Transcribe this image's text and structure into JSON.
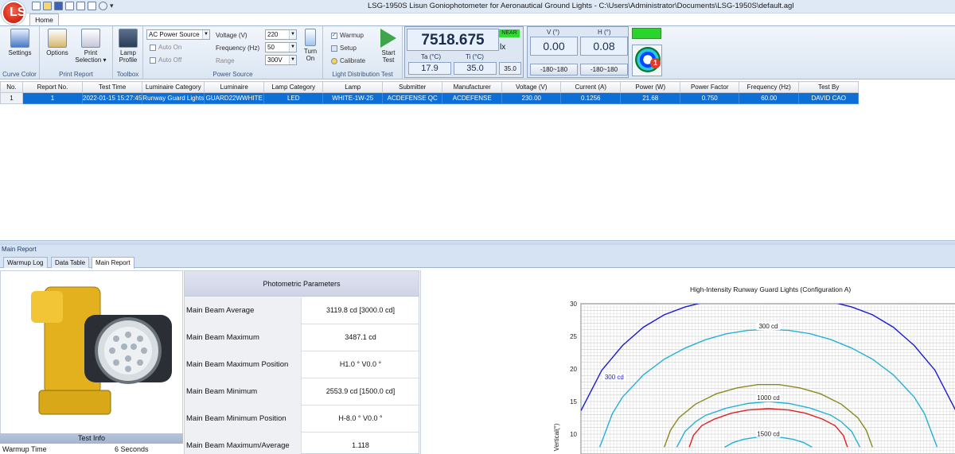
{
  "app": {
    "window_title": "LSG-1950S Lisun Goniophotometer for Aeronautical Ground Lights - C:\\Users\\Administrator\\Documents\\LSG-1950S\\default.agl",
    "logo_text": "LS",
    "ribbon_tab": "Home"
  },
  "ribbon": {
    "curve_color": {
      "settings": "Settings",
      "group": "Curve Color"
    },
    "print_report": {
      "options": "Options",
      "print_selection": "Print Selection ▾",
      "group": "Print Report"
    },
    "toolbox": {
      "lamp_profile": "Lamp Profile",
      "group": "Toolbox"
    },
    "power_source": {
      "source_select": "AC Power Source",
      "auto_on": "Auto On",
      "auto_off": "Auto Off",
      "voltage_label": "Voltage (V)",
      "voltage_value": "220",
      "frequency_label": "Frequency (Hz)",
      "frequency_value": "50",
      "range_label": "Range",
      "range_value": "300V",
      "turn_on": "Turn On",
      "group": "Power Source"
    },
    "light_test": {
      "warmup": "Warmup",
      "setup": "Setup",
      "calibrate": "Calibrate",
      "start": "Start Test",
      "group": "Light Distribution Test"
    }
  },
  "readout": {
    "value": "7518.675",
    "range_badge": "NEAR",
    "unit": "lx",
    "ta_label": "Ta (°C)",
    "ta_value": "17.9",
    "ti_label": "Ti (°C)",
    "ti_value": "35.0",
    "small_value": "35.0"
  },
  "angles": {
    "v_label": "V (°)",
    "v_value": "0.00",
    "h_label": "H (°)",
    "h_value": "0.08",
    "v_range": "-180~180",
    "h_range": "-180~180",
    "notification_count": "1"
  },
  "grid": {
    "columns": [
      "No.",
      "Report No.",
      "Test Time",
      "Luminaire Category",
      "Luminaire",
      "Lamp Category",
      "Lamp",
      "Submitter",
      "Manufacturer",
      "Voltage (V)",
      "Current (A)",
      "Power (W)",
      "Power Factor",
      "Frequency (Hz)",
      "Test By"
    ],
    "rows": [
      [
        "1",
        "1",
        "2022-01-15 15:27:45",
        "Runway Guard Lights",
        "GUARD22WWHITE",
        "LED",
        "WHITE-1W-25",
        "ACDEFENSE QC",
        "ACDEFENSE",
        "230.00",
        "0.1256",
        "21.68",
        "0.750",
        "60.00",
        "DAVID CAO"
      ]
    ]
  },
  "lower": {
    "panel_title": "Main Report",
    "tabs": [
      "Warmup Log",
      "Data Table",
      "Main Report"
    ],
    "test_info_header": "Test Info",
    "test_info": [
      {
        "label": "Warmup Time",
        "value": "6 Seconds"
      }
    ],
    "params_header": "Photometric Parameters",
    "params": [
      {
        "label": "Main Beam Average",
        "value": "3119.8 cd [3000.0 cd]"
      },
      {
        "label": "Main Beam Maximum",
        "value": "3487.1 cd"
      },
      {
        "label": "Main Beam Maximum Position",
        "value": "H1.0 ° V0.0 °"
      },
      {
        "label": "Main Beam Minimum",
        "value": "2553.9 cd [1500.0 cd]"
      },
      {
        "label": "Main Beam Minimum Position",
        "value": "H-8.0 ° V0.0 °"
      },
      {
        "label": "Main Beam Maximum/Average",
        "value": "1.118"
      }
    ]
  },
  "chart_data": {
    "type": "line",
    "title": "High-Intensity Runway Guard Lights (Configuration A)",
    "ylabel": "Vertical(°)",
    "xlabel": "",
    "y_ticks": [
      10,
      15,
      20,
      25,
      30
    ],
    "ylim": [
      8,
      30
    ],
    "xlim": [
      -9,
      9
    ],
    "grid": true,
    "contour_labels": [
      {
        "text": "300 cd",
        "x": 0.0,
        "y": 26.1
      },
      {
        "text": "300 cd",
        "x": -7.4,
        "y": 18.3
      },
      {
        "text": "1000 cd",
        "x": 0.0,
        "y": 15.1
      },
      {
        "text": "1500 cd",
        "x": 0.0,
        "y": 9.6
      }
    ],
    "series": [
      {
        "color": "#1a1ad0",
        "x": [
          -9,
          -8,
          -7,
          -6,
          -5,
          -4,
          -3,
          -2,
          -1,
          0,
          1,
          2,
          3,
          4,
          5,
          6,
          7,
          8,
          9
        ],
        "y": [
          13.6,
          19.8,
          23.6,
          26.4,
          28.3,
          29.5,
          30.3,
          30.9,
          31.2,
          31.3,
          31.2,
          30.9,
          30.3,
          29.5,
          28.3,
          26.4,
          23.6,
          19.8,
          13.6
        ]
      },
      {
        "color": "#23b2d6",
        "x": [
          -8.1,
          -7.5,
          -7,
          -6,
          -5,
          -4,
          -3,
          -2,
          -1,
          0,
          1,
          2,
          3,
          4,
          5,
          6,
          7,
          7.5,
          8.1
        ],
        "y": [
          8.0,
          13.1,
          15.7,
          19.1,
          21.5,
          23.2,
          24.5,
          25.4,
          25.9,
          26.1,
          25.9,
          25.4,
          24.5,
          23.2,
          21.5,
          19.1,
          15.7,
          13.1,
          8.0
        ]
      },
      {
        "color": "#8a8a1e",
        "x": [
          -5.0,
          -4.7,
          -4.3,
          -3.5,
          -2.5,
          -1.5,
          -0.5,
          0.5,
          1.5,
          2.5,
          3.5,
          4.3,
          4.7,
          5.0
        ],
        "y": [
          8.0,
          10.6,
          12.5,
          14.6,
          16.2,
          17.1,
          17.6,
          17.6,
          17.1,
          16.2,
          14.6,
          12.5,
          10.6,
          8.0
        ]
      },
      {
        "color": "#23b2d6",
        "x": [
          -4.4,
          -4,
          -3.5,
          -3,
          -2,
          -1,
          0,
          1,
          2,
          3,
          3.5,
          4,
          4.4
        ],
        "y": [
          8.0,
          10.4,
          11.9,
          12.9,
          14.0,
          14.7,
          15.0,
          14.7,
          14.0,
          12.9,
          11.9,
          10.4,
          8.0
        ]
      },
      {
        "color": "#e02020",
        "x": [
          -3.8,
          -3.6,
          -3.2,
          -2.6,
          -1.8,
          -1,
          0,
          1,
          1.8,
          2.6,
          3.2,
          3.6,
          3.8
        ],
        "y": [
          8.0,
          9.8,
          11.3,
          12.3,
          13.2,
          13.7,
          13.9,
          13.7,
          13.2,
          12.3,
          11.3,
          9.8,
          8.0
        ]
      },
      {
        "color": "#23b2d6",
        "x": [
          -2.1,
          -1.7,
          -1.2,
          -0.6,
          0,
          0.6,
          1.2,
          1.7,
          2.1
        ],
        "y": [
          8.0,
          8.7,
          9.2,
          9.5,
          9.6,
          9.5,
          9.2,
          8.7,
          8.0
        ]
      }
    ]
  }
}
